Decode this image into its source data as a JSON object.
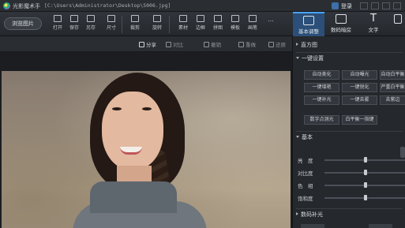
{
  "title_bar": {
    "app_title": "光影魔术手",
    "file_path": "[C:\\Users\\Administrator\\Desktop\\5006.jpg]",
    "login_label": "登录"
  },
  "toolbar": {
    "open_button": "浏览图片",
    "tools": [
      {
        "label": "打开",
        "icon": "open-icon"
      },
      {
        "label": "保存",
        "icon": "save-icon"
      },
      {
        "label": "另存",
        "icon": "save-as-icon"
      },
      {
        "label": "尺寸",
        "icon": "resize-icon"
      },
      {
        "label": "裁剪",
        "icon": "crop-icon"
      },
      {
        "label": "旋转",
        "icon": "rotate-icon"
      },
      {
        "label": "素材",
        "icon": "material-icon"
      },
      {
        "label": "边框",
        "icon": "border-icon"
      },
      {
        "label": "拼图",
        "icon": "collage-icon"
      },
      {
        "label": "模板",
        "icon": "template-icon"
      },
      {
        "label": "画笔",
        "icon": "brush-icon"
      },
      {
        "label": "...",
        "icon": "more-icon"
      }
    ],
    "tabs": [
      {
        "label": "基本调整",
        "icon": "adjust-icon",
        "active": true
      },
      {
        "label": "数码暗房",
        "icon": "darkroom-icon",
        "active": false
      },
      {
        "label": "文字",
        "icon": "text-icon",
        "active": false
      }
    ]
  },
  "sub_toolbar": {
    "share": "分享",
    "compare": "对比",
    "undo": "撤销",
    "redo": "重做",
    "restore": "还原"
  },
  "panel": {
    "sections": {
      "histogram": "直方图",
      "one_click": "一键设置",
      "basic": "基本",
      "color_fill": "数码补光"
    },
    "one_click_buttons": [
      "自动美化",
      "自动曝光",
      "自动白平衡",
      "一键增艳",
      "一键锐化",
      "严重白平衡",
      "一键补光",
      "一键去雾",
      "去紫边"
    ],
    "extra_buttons": [
      "数字点测光",
      "白平衡一指键"
    ],
    "sliders": [
      {
        "label": "亮　度",
        "value": 0.5
      },
      {
        "label": "对比度",
        "value": 0.5
      },
      {
        "label": "色　相",
        "value": 0.5
      },
      {
        "label": "饱和度",
        "value": 0.5
      }
    ]
  },
  "colors": {
    "accent": "#2b4f78",
    "highlight": "#4aa3ff",
    "background": "#1f2227"
  }
}
